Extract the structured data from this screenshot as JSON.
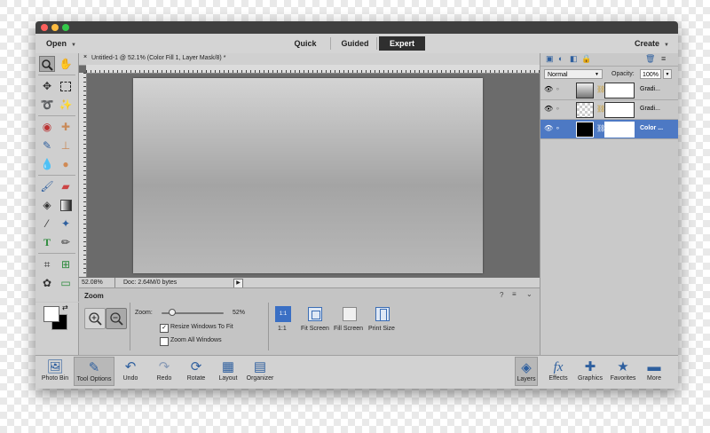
{
  "colors": {
    "accent": "#3a6fc4",
    "selected_layer": "#4d79c4"
  },
  "menubar": {
    "open_label": "Open",
    "create_label": "Create",
    "modes": [
      "Quick",
      "Guided",
      "Expert"
    ],
    "active_mode": "Expert"
  },
  "document": {
    "tab_title": "Untitled-1 @ 52.1% (Color Fill 1, Layer Mask/8) *",
    "zoom_status": "52.08%",
    "doc_info": "Doc: 2.64M/0 bytes"
  },
  "tool_options": {
    "title": "Zoom",
    "zoom_label": "Zoom:",
    "zoom_value": "52%",
    "zoom_level": 0.52,
    "resize_windows_label": "Resize Windows To Fit",
    "resize_windows_checked": true,
    "zoom_all_label": "Zoom All Windows",
    "zoom_all_checked": false,
    "buttons": [
      "1:1",
      "Fit Screen",
      "Fill Screen",
      "Print Size"
    ]
  },
  "layers_panel": {
    "blend_mode": "Normal",
    "opacity_label": "Opacity:",
    "opacity_value": "100%",
    "layers": [
      {
        "name": "Gradi...",
        "selected": false
      },
      {
        "name": "Gradi...",
        "selected": false
      },
      {
        "name": "Color ...",
        "selected": true
      }
    ]
  },
  "bottom_bar": {
    "left": [
      "Photo Bin",
      "Tool Options",
      "Undo",
      "Redo",
      "Rotate",
      "Layout",
      "Organizer"
    ],
    "right": [
      "Layers",
      "Effects",
      "Graphics",
      "Favorites",
      "More"
    ]
  }
}
